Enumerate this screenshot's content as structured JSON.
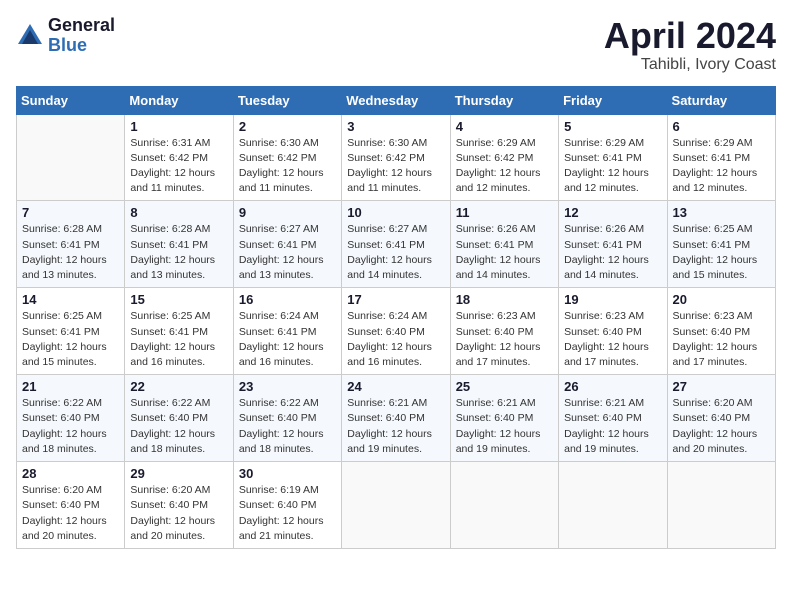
{
  "header": {
    "logo_general": "General",
    "logo_blue": "Blue",
    "month_title": "April 2024",
    "location": "Tahibli, Ivory Coast"
  },
  "calendar": {
    "days_of_week": [
      "Sunday",
      "Monday",
      "Tuesday",
      "Wednesday",
      "Thursday",
      "Friday",
      "Saturday"
    ],
    "weeks": [
      [
        {
          "day": "",
          "info": ""
        },
        {
          "day": "1",
          "info": "Sunrise: 6:31 AM\nSunset: 6:42 PM\nDaylight: 12 hours\nand 11 minutes."
        },
        {
          "day": "2",
          "info": "Sunrise: 6:30 AM\nSunset: 6:42 PM\nDaylight: 12 hours\nand 11 minutes."
        },
        {
          "day": "3",
          "info": "Sunrise: 6:30 AM\nSunset: 6:42 PM\nDaylight: 12 hours\nand 11 minutes."
        },
        {
          "day": "4",
          "info": "Sunrise: 6:29 AM\nSunset: 6:42 PM\nDaylight: 12 hours\nand 12 minutes."
        },
        {
          "day": "5",
          "info": "Sunrise: 6:29 AM\nSunset: 6:41 PM\nDaylight: 12 hours\nand 12 minutes."
        },
        {
          "day": "6",
          "info": "Sunrise: 6:29 AM\nSunset: 6:41 PM\nDaylight: 12 hours\nand 12 minutes."
        }
      ],
      [
        {
          "day": "7",
          "info": "Sunrise: 6:28 AM\nSunset: 6:41 PM\nDaylight: 12 hours\nand 13 minutes."
        },
        {
          "day": "8",
          "info": "Sunrise: 6:28 AM\nSunset: 6:41 PM\nDaylight: 12 hours\nand 13 minutes."
        },
        {
          "day": "9",
          "info": "Sunrise: 6:27 AM\nSunset: 6:41 PM\nDaylight: 12 hours\nand 13 minutes."
        },
        {
          "day": "10",
          "info": "Sunrise: 6:27 AM\nSunset: 6:41 PM\nDaylight: 12 hours\nand 14 minutes."
        },
        {
          "day": "11",
          "info": "Sunrise: 6:26 AM\nSunset: 6:41 PM\nDaylight: 12 hours\nand 14 minutes."
        },
        {
          "day": "12",
          "info": "Sunrise: 6:26 AM\nSunset: 6:41 PM\nDaylight: 12 hours\nand 14 minutes."
        },
        {
          "day": "13",
          "info": "Sunrise: 6:25 AM\nSunset: 6:41 PM\nDaylight: 12 hours\nand 15 minutes."
        }
      ],
      [
        {
          "day": "14",
          "info": "Sunrise: 6:25 AM\nSunset: 6:41 PM\nDaylight: 12 hours\nand 15 minutes."
        },
        {
          "day": "15",
          "info": "Sunrise: 6:25 AM\nSunset: 6:41 PM\nDaylight: 12 hours\nand 16 minutes."
        },
        {
          "day": "16",
          "info": "Sunrise: 6:24 AM\nSunset: 6:41 PM\nDaylight: 12 hours\nand 16 minutes."
        },
        {
          "day": "17",
          "info": "Sunrise: 6:24 AM\nSunset: 6:40 PM\nDaylight: 12 hours\nand 16 minutes."
        },
        {
          "day": "18",
          "info": "Sunrise: 6:23 AM\nSunset: 6:40 PM\nDaylight: 12 hours\nand 17 minutes."
        },
        {
          "day": "19",
          "info": "Sunrise: 6:23 AM\nSunset: 6:40 PM\nDaylight: 12 hours\nand 17 minutes."
        },
        {
          "day": "20",
          "info": "Sunrise: 6:23 AM\nSunset: 6:40 PM\nDaylight: 12 hours\nand 17 minutes."
        }
      ],
      [
        {
          "day": "21",
          "info": "Sunrise: 6:22 AM\nSunset: 6:40 PM\nDaylight: 12 hours\nand 18 minutes."
        },
        {
          "day": "22",
          "info": "Sunrise: 6:22 AM\nSunset: 6:40 PM\nDaylight: 12 hours\nand 18 minutes."
        },
        {
          "day": "23",
          "info": "Sunrise: 6:22 AM\nSunset: 6:40 PM\nDaylight: 12 hours\nand 18 minutes."
        },
        {
          "day": "24",
          "info": "Sunrise: 6:21 AM\nSunset: 6:40 PM\nDaylight: 12 hours\nand 19 minutes."
        },
        {
          "day": "25",
          "info": "Sunrise: 6:21 AM\nSunset: 6:40 PM\nDaylight: 12 hours\nand 19 minutes."
        },
        {
          "day": "26",
          "info": "Sunrise: 6:21 AM\nSunset: 6:40 PM\nDaylight: 12 hours\nand 19 minutes."
        },
        {
          "day": "27",
          "info": "Sunrise: 6:20 AM\nSunset: 6:40 PM\nDaylight: 12 hours\nand 20 minutes."
        }
      ],
      [
        {
          "day": "28",
          "info": "Sunrise: 6:20 AM\nSunset: 6:40 PM\nDaylight: 12 hours\nand 20 minutes."
        },
        {
          "day": "29",
          "info": "Sunrise: 6:20 AM\nSunset: 6:40 PM\nDaylight: 12 hours\nand 20 minutes."
        },
        {
          "day": "30",
          "info": "Sunrise: 6:19 AM\nSunset: 6:40 PM\nDaylight: 12 hours\nand 21 minutes."
        },
        {
          "day": "",
          "info": ""
        },
        {
          "day": "",
          "info": ""
        },
        {
          "day": "",
          "info": ""
        },
        {
          "day": "",
          "info": ""
        }
      ]
    ]
  }
}
